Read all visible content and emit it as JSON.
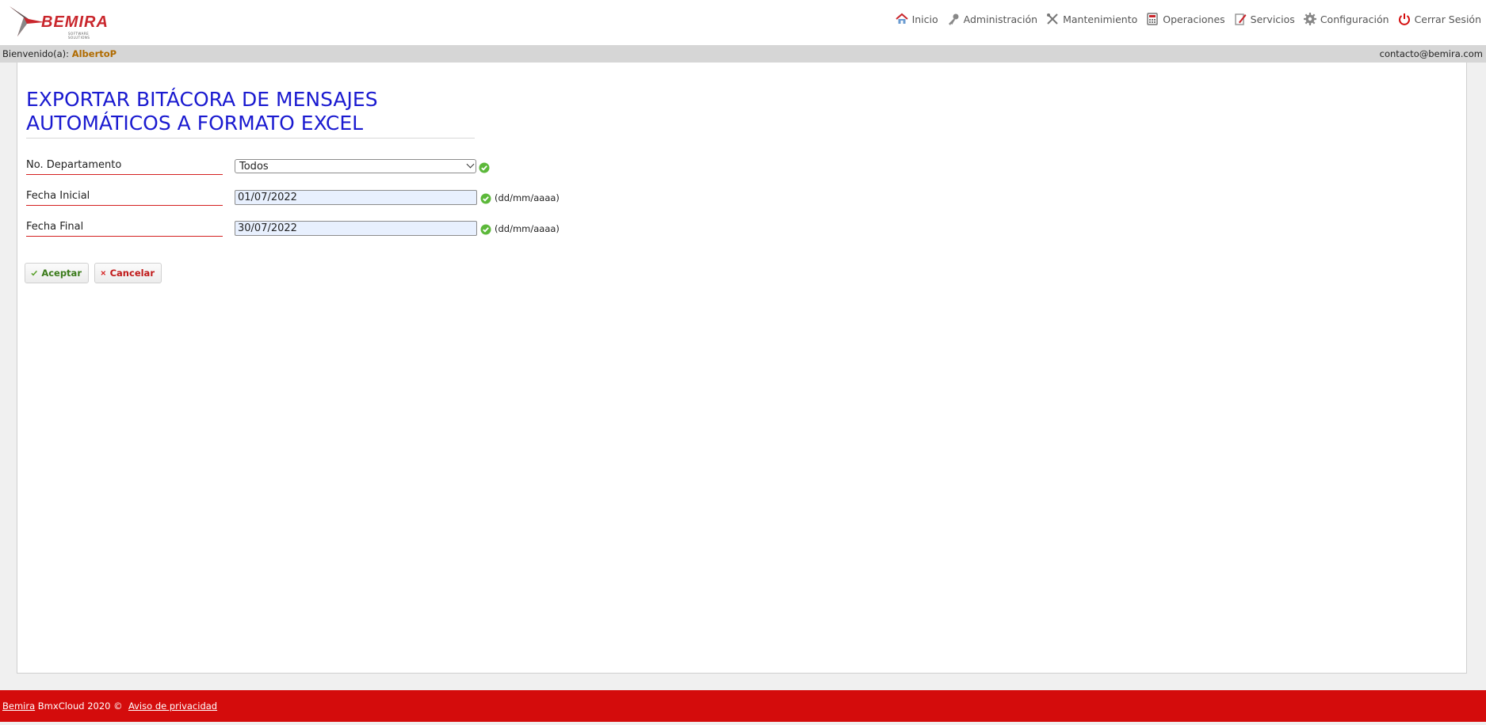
{
  "header": {
    "logo_text": "BEMIRA",
    "logo_sub": "SOFTWARE SOLUTIONS",
    "nav": [
      {
        "label": "Inicio",
        "icon": "home-icon"
      },
      {
        "label": "Administración",
        "icon": "key-icon"
      },
      {
        "label": "Mantenimiento",
        "icon": "tools-icon"
      },
      {
        "label": "Operaciones",
        "icon": "calculator-icon"
      },
      {
        "label": "Servicios",
        "icon": "edit-icon"
      },
      {
        "label": "Configuración",
        "icon": "gear-icon"
      },
      {
        "label": "Cerrar Sesión",
        "icon": "power-icon"
      }
    ]
  },
  "userbar": {
    "welcome_label": "Bienvenido(a):",
    "username": "AlbertoP",
    "contact": "contacto@bemira.com"
  },
  "page": {
    "title_line1": "EXPORTAR BITÁCORA DE MENSAJES",
    "title_line2": "AUTOMÁTICOS A FORMATO EXCEL"
  },
  "form": {
    "department": {
      "label": "No. Departamento",
      "value": "Todos"
    },
    "start_date": {
      "label": "Fecha Inicial",
      "value": "01/07/2022",
      "hint": "(dd/mm/aaaa)"
    },
    "end_date": {
      "label": "Fecha Final",
      "value": "30/07/2022",
      "hint": "(dd/mm/aaaa)"
    }
  },
  "buttons": {
    "accept": "Aceptar",
    "cancel": "Cancelar"
  },
  "footer": {
    "company_link": "Bemira",
    "copyright": " BmxCloud 2020 ©  ",
    "privacy_link": "Aviso de privacidad"
  },
  "colors": {
    "title": "#1a1ad0",
    "label_underline": "#d42020",
    "footer_bg": "#d40c0c",
    "username": "#b06b00",
    "accept_text": "#3a7a1a",
    "cancel_text": "#c01818"
  }
}
